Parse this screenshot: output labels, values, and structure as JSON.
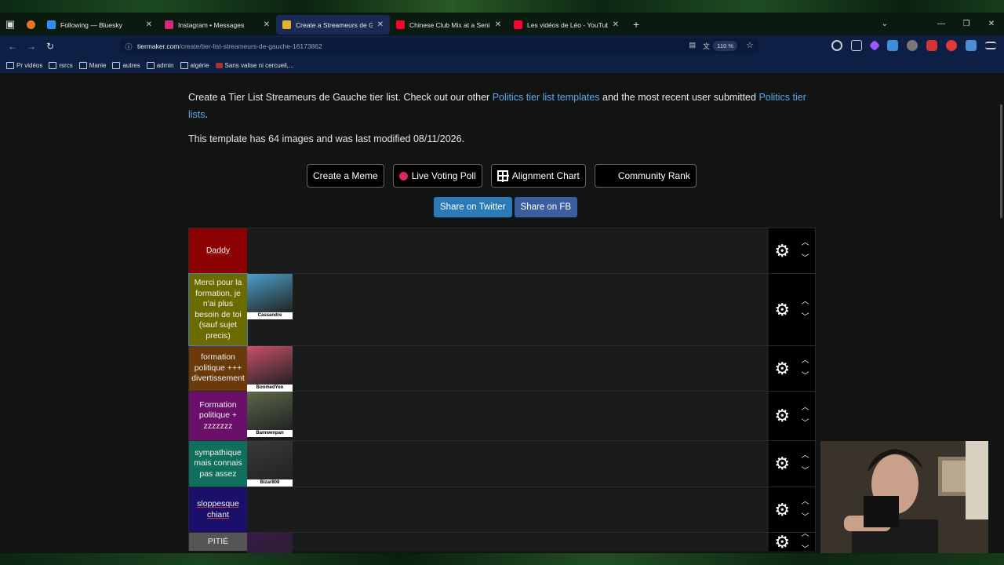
{
  "browser": {
    "tabs": [
      {
        "label": "Following — Bluesky",
        "icon": "bluesky-icon",
        "color": "#2f8df5",
        "active": false
      },
      {
        "label": "Instagram • Messages",
        "icon": "instagram-icon",
        "color": "#d6297a",
        "active": false
      },
      {
        "label": "Create a Streameurs de Gauche",
        "icon": "tiermaker-icon",
        "color": "#e5b22e",
        "active": true
      },
      {
        "label": "Chinese Club Mix at a Seni",
        "icon": "youtube-icon",
        "color": "#ff0033",
        "active": false
      },
      {
        "label": "Les vidéos de Léo - YouTube",
        "icon": "youtube-icon",
        "color": "#ff0033",
        "active": false
      }
    ],
    "url_host": "tiermaker.com",
    "url_path": "/create/tier-list-streameurs-de-gauche-16173862",
    "zoom": "110 %",
    "bookmarks": [
      "Pr vidéos",
      "rsrcs",
      "Manie",
      "autres",
      "admin",
      "algérie",
      "Sans valise ni cercueil,..."
    ]
  },
  "page": {
    "intro_pre": "Create a Tier List Streameurs de Gauche tier list. Check out our other ",
    "intro_link1": "Politics tier list templates",
    "intro_mid": " and the most recent user submitted ",
    "intro_link2": "Politics tier lists",
    "intro_end": ".",
    "meta": "This template has 64 images and was last modified 08/11/2026.",
    "buttons": {
      "meme": "Create a Meme",
      "poll": "Live Voting Poll",
      "alignment": "Alignment Chart",
      "community": "Community Rank"
    },
    "share_twitter": "Share on Twitter",
    "share_fb": "Share on FB"
  },
  "tiers": [
    {
      "label": "Daddy",
      "color": "#8b0000",
      "height": 58,
      "items": []
    },
    {
      "label": "Merci pour la formation, je n'ai plus besoin de toi (sauf sujet precis)",
      "color": "#6b6b00",
      "height": 92,
      "items": [
        {
          "name": "Cassandre",
          "bg": "#4aa0c8"
        }
      ]
    },
    {
      "label": "formation politique +++ divertissement",
      "color": "#6b3a0a",
      "height": 58,
      "items": [
        {
          "name": "BoomedYen",
          "bg": "#c8506a"
        }
      ]
    },
    {
      "label": "Formation politique + zzzzzzz",
      "color": "#6a0f6a",
      "height": 63,
      "items": [
        {
          "name": "Bamwenpan",
          "bg": "#5a6a4a"
        }
      ]
    },
    {
      "label": "sympathique mais connais pas assez",
      "color": "#0f6f5c",
      "height": 59,
      "items": [
        {
          "name": "Bizar808",
          "bg": "#3a3a3a"
        }
      ]
    },
    {
      "label": "sloppesque chiant",
      "color": "#1a0f6a",
      "height": 58,
      "items": []
    },
    {
      "label": "PITIÉ",
      "color": "#555555",
      "height": 40,
      "items": [
        {
          "name": "",
          "bg": "#3a1a4a"
        }
      ]
    }
  ]
}
